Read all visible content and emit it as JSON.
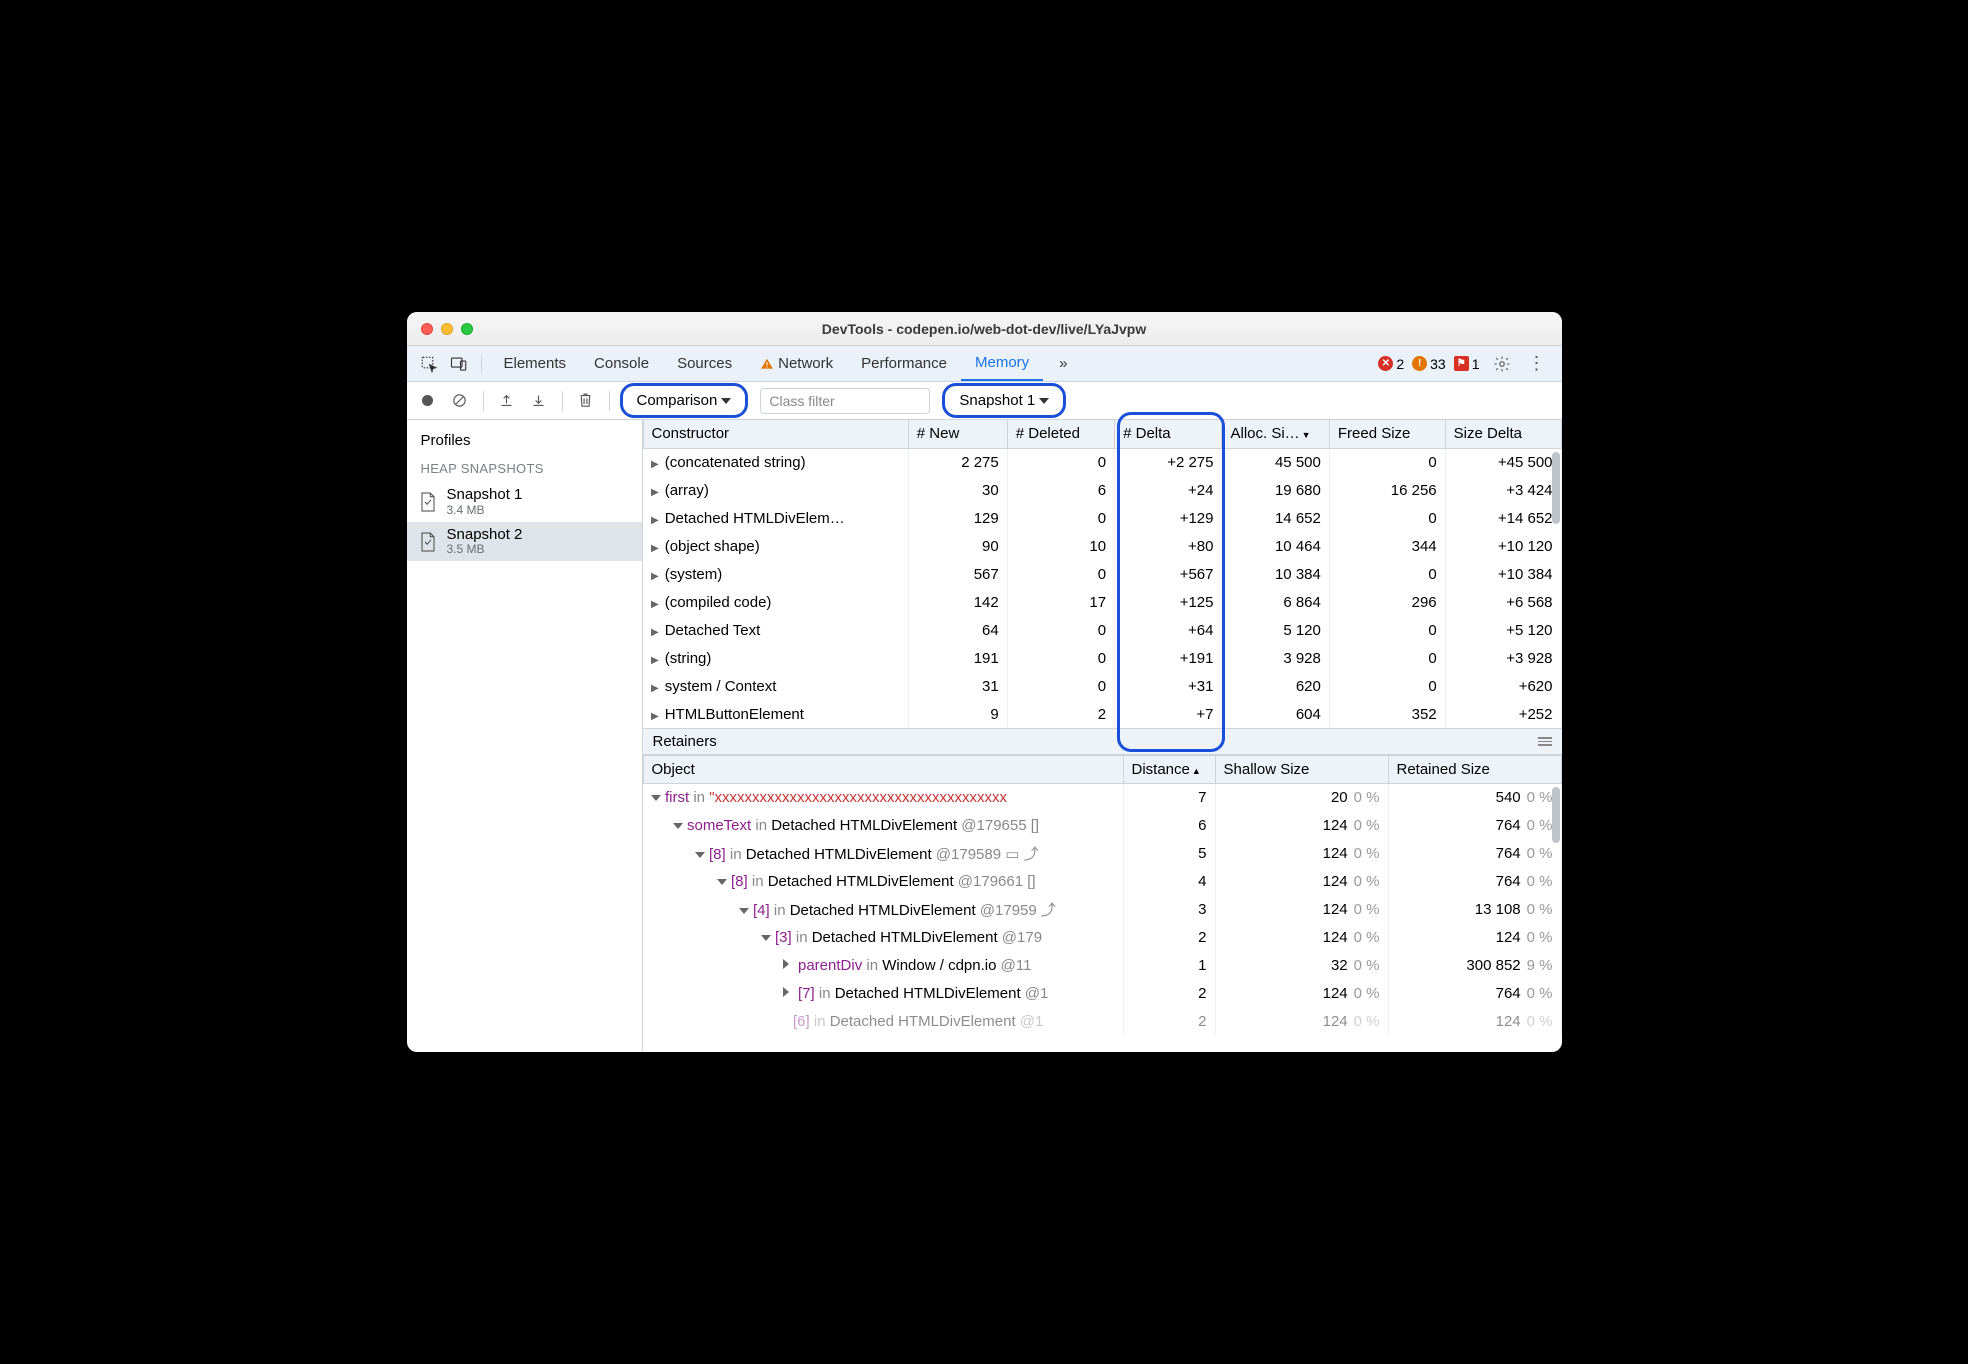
{
  "window_title": "DevTools - codepen.io/web-dot-dev/live/LYaJvpw",
  "tabs": {
    "items": [
      "Elements",
      "Console",
      "Sources",
      "Network",
      "Performance",
      "Memory"
    ],
    "active": "Memory",
    "network_has_warning": true,
    "overflow": "»"
  },
  "status": {
    "errors": 2,
    "warnings": 33,
    "issues": 1
  },
  "toolbar": {
    "mode_label": "Comparison",
    "filter_placeholder": "Class filter",
    "base_label": "Snapshot 1"
  },
  "sidebar": {
    "heading": "Profiles",
    "section": "HEAP SNAPSHOTS",
    "snapshots": [
      {
        "name": "Snapshot 1",
        "size": "3.4 MB",
        "active": false
      },
      {
        "name": "Snapshot 2",
        "size": "3.5 MB",
        "active": true
      }
    ]
  },
  "columns": [
    "Constructor",
    "# New",
    "# Deleted",
    "# Delta",
    "Alloc. Si…",
    "Freed Size",
    "Size Delta"
  ],
  "sorted_col": 4,
  "rows": [
    {
      "c": "(concatenated string)",
      "new": "2 275",
      "del": "0",
      "delta": "+2 275",
      "alloc": "45 500",
      "freed": "0",
      "sdelta": "+45 500"
    },
    {
      "c": "(array)",
      "new": "30",
      "del": "6",
      "delta": "+24",
      "alloc": "19 680",
      "freed": "16 256",
      "sdelta": "+3 424"
    },
    {
      "c": "Detached HTMLDivElem…",
      "new": "129",
      "del": "0",
      "delta": "+129",
      "alloc": "14 652",
      "freed": "0",
      "sdelta": "+14 652"
    },
    {
      "c": "(object shape)",
      "new": "90",
      "del": "10",
      "delta": "+80",
      "alloc": "10 464",
      "freed": "344",
      "sdelta": "+10 120"
    },
    {
      "c": "(system)",
      "new": "567",
      "del": "0",
      "delta": "+567",
      "alloc": "10 384",
      "freed": "0",
      "sdelta": "+10 384"
    },
    {
      "c": "(compiled code)",
      "new": "142",
      "del": "17",
      "delta": "+125",
      "alloc": "6 864",
      "freed": "296",
      "sdelta": "+6 568"
    },
    {
      "c": "Detached Text",
      "new": "64",
      "del": "0",
      "delta": "+64",
      "alloc": "5 120",
      "freed": "0",
      "sdelta": "+5 120"
    },
    {
      "c": "(string)",
      "new": "191",
      "del": "0",
      "delta": "+191",
      "alloc": "3 928",
      "freed": "0",
      "sdelta": "+3 928"
    },
    {
      "c": "system / Context",
      "new": "31",
      "del": "0",
      "delta": "+31",
      "alloc": "620",
      "freed": "0",
      "sdelta": "+620"
    },
    {
      "c": "HTMLButtonElement",
      "new": "9",
      "del": "2",
      "delta": "+7",
      "alloc": "604",
      "freed": "352",
      "sdelta": "+252"
    }
  ],
  "retainers_heading": "Retainers",
  "ret_columns": [
    "Object",
    "Distance",
    "Shallow Size",
    "Retained Size"
  ],
  "ret_sorted": 1,
  "retainers": [
    {
      "indent": 0,
      "exp": "d",
      "pre": "first",
      "mid": "in",
      "obj": "\"xxxxxxxxxxxxxxxxxxxxxxxxxxxxxxxxxxxxxxx",
      "dist": "7",
      "sh": "20",
      "shp": "0 %",
      "ret": "540",
      "retp": "0 %",
      "objcls": "red",
      "icons": ""
    },
    {
      "indent": 1,
      "exp": "d",
      "pre": "someText",
      "mid": "in",
      "obj": "Detached HTMLDivElement",
      "id": "@179655",
      "dist": "6",
      "sh": "124",
      "shp": "0 %",
      "ret": "764",
      "retp": "0 %",
      "icons": "[]"
    },
    {
      "indent": 2,
      "exp": "d",
      "pre": "[8]",
      "mid": "in",
      "obj": "Detached HTMLDivElement",
      "id": "@179589",
      "dist": "5",
      "sh": "124",
      "shp": "0 %",
      "ret": "764",
      "retp": "0 %",
      "icons": "▭ ⤴"
    },
    {
      "indent": 3,
      "exp": "d",
      "pre": "[8]",
      "mid": "in",
      "obj": "Detached HTMLDivElement",
      "id": "@179661",
      "dist": "4",
      "sh": "124",
      "shp": "0 %",
      "ret": "764",
      "retp": "0 %",
      "icons": "[]"
    },
    {
      "indent": 4,
      "exp": "d",
      "pre": "[4]",
      "mid": "in",
      "obj": "Detached HTMLDivElement",
      "id": "@17959",
      "dist": "3",
      "sh": "124",
      "shp": "0 %",
      "ret": "13 108",
      "retp": "0 %",
      "icons": "⤴"
    },
    {
      "indent": 5,
      "exp": "d",
      "pre": "[3]",
      "mid": "in",
      "obj": "Detached HTMLDivElement",
      "id": "@179",
      "dist": "2",
      "sh": "124",
      "shp": "0 %",
      "ret": "124",
      "retp": "0 %",
      "icons": ""
    },
    {
      "indent": 6,
      "exp": "r",
      "pre": "parentDiv",
      "mid": "in",
      "obj": "Window / cdpn.io",
      "id": "@11",
      "dist": "1",
      "sh": "32",
      "shp": "0 %",
      "ret": "300 852",
      "retp": "9 %",
      "icons": ""
    },
    {
      "indent": 6,
      "exp": "r",
      "pre": "[7]",
      "mid": "in",
      "obj": "Detached HTMLDivElement",
      "id": "@1",
      "dist": "2",
      "sh": "124",
      "shp": "0 %",
      "ret": "764",
      "retp": "0 %",
      "icons": ""
    },
    {
      "indent": 6,
      "exp": "",
      "pre": "[6]",
      "mid": "in",
      "obj": "Detached HTMLDivElement",
      "id": "@1",
      "dist": "2",
      "sh": "124",
      "shp": "0 %",
      "ret": "124",
      "retp": "0 %",
      "icons": "",
      "faded": true
    }
  ]
}
